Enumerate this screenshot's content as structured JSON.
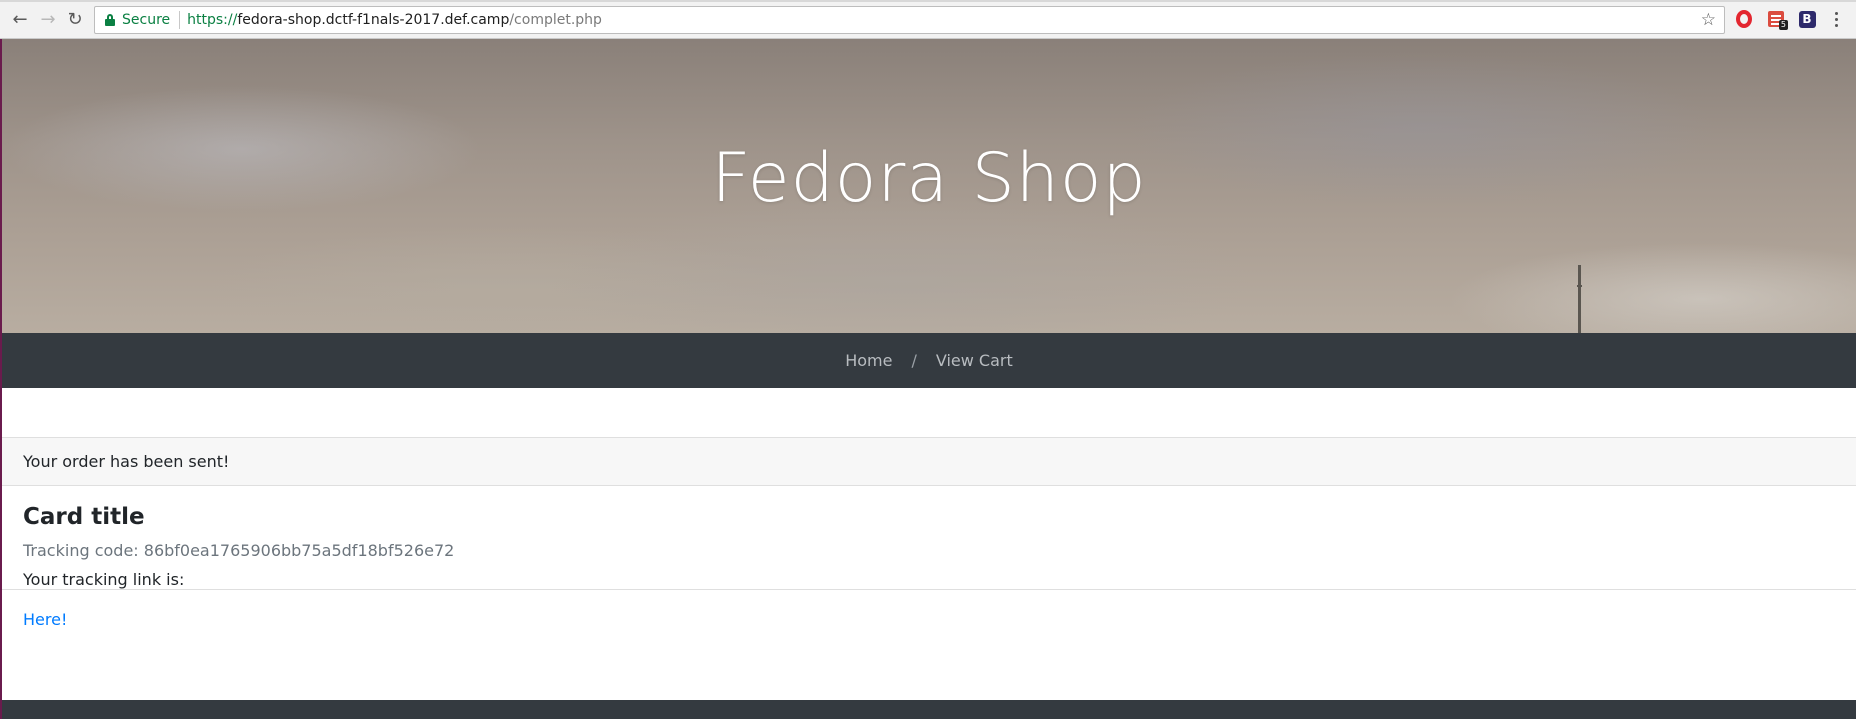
{
  "browser": {
    "security_label": "Secure",
    "url_scheme": "https://",
    "url_host": "fedora-shop.dctf-f1nals-2017.def.camp",
    "url_path": "/complet.php",
    "extension_badge": "5",
    "extension_b_label": "B"
  },
  "hero": {
    "title": "Fedora Shop"
  },
  "nav": {
    "home_label": "Home",
    "divider": "/",
    "cart_label": "View Cart"
  },
  "order": {
    "header": "Your order has been sent!",
    "card_title": "Card title",
    "tracking_code": "Tracking code: 86bf0ea1765906bb75a5df18bf526e72",
    "tracking_text": "Your tracking link is:",
    "link_label": "Here!"
  }
}
